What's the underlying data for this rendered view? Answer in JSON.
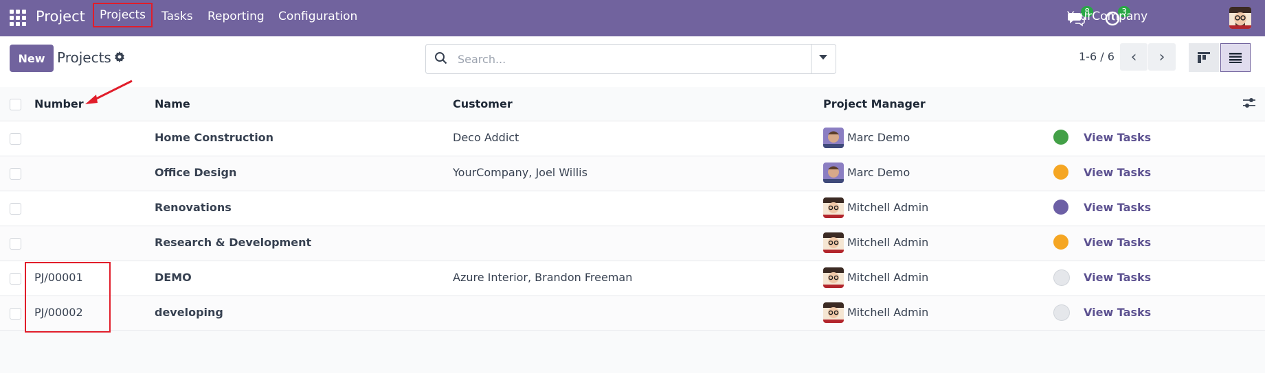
{
  "topbar": {
    "app_name": "Project",
    "menus": [
      "Projects",
      "Tasks",
      "Reporting",
      "Configuration"
    ],
    "messages_count": "8",
    "activities_count": "3",
    "company": "YourCompany",
    "bg_color": "#71639e",
    "badge_color": "#28a745"
  },
  "control": {
    "new_label": "New",
    "title": "Projects",
    "search_placeholder": "Search...",
    "pager": "1-6 / 6"
  },
  "table": {
    "headers": {
      "number": "Number",
      "name": "Name",
      "customer": "Customer",
      "manager": "Project Manager"
    },
    "action_label": "View Tasks",
    "rows": [
      {
        "number": "",
        "name": "Home Construction",
        "customer": "Deco Addict",
        "manager": "Marc Demo",
        "status": "#43a047"
      },
      {
        "number": "",
        "name": "Office Design",
        "customer": "YourCompany, Joel Willis",
        "manager": "Marc Demo",
        "status": "#f5a623"
      },
      {
        "number": "",
        "name": "Renovations",
        "customer": "",
        "manager": "Mitchell Admin",
        "status": "#6c5fa5"
      },
      {
        "number": "",
        "name": "Research & Development",
        "customer": "",
        "manager": "Mitchell Admin",
        "status": "#f5a623"
      },
      {
        "number": "PJ/00001",
        "name": "DEMO",
        "customer": "Azure Interior, Brandon Freeman",
        "manager": "Mitchell Admin",
        "status": "#e5e7eb"
      },
      {
        "number": "PJ/00002",
        "name": "developing",
        "customer": "",
        "manager": "Mitchell Admin",
        "status": "#e5e7eb"
      }
    ]
  }
}
